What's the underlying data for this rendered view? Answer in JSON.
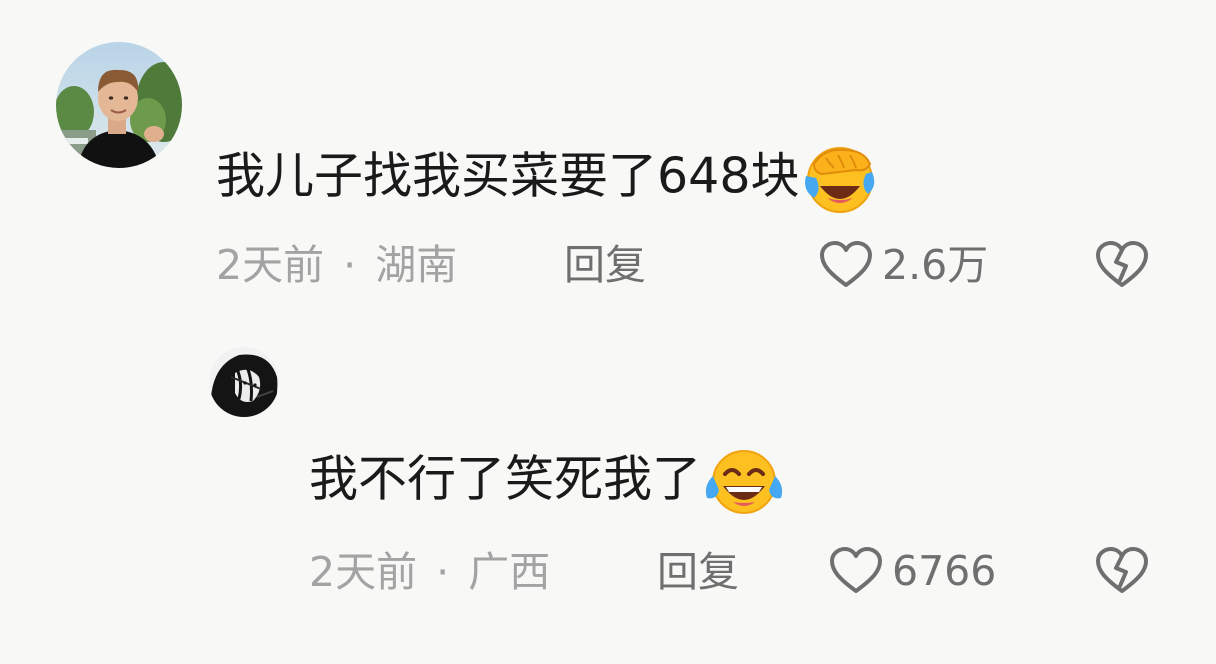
{
  "comments": [
    {
      "text": "我儿子找我买菜要了648块",
      "emoji": "face-with-hand-over-eyes-crying-laughing-emoji",
      "time": "2天前",
      "separator": "·",
      "location": "湖南",
      "reply_label": "回复",
      "like_icon": "heart-outline-icon",
      "likes": "2.6万",
      "dislike_icon": "broken-heart-icon"
    },
    {
      "text": "我不行了笑死我了",
      "emoji": "face-with-tears-of-joy-emoji",
      "time": "2天前",
      "separator": "·",
      "location": "广西",
      "reply_label": "回复",
      "like_icon": "heart-outline-icon",
      "likes": "6766",
      "dislike_icon": "broken-heart-icon"
    }
  ],
  "colors": {
    "background": "#f8f8f6",
    "text": "#1a1a1a",
    "meta": "#a3a3a3",
    "action": "#6f6f6f"
  }
}
